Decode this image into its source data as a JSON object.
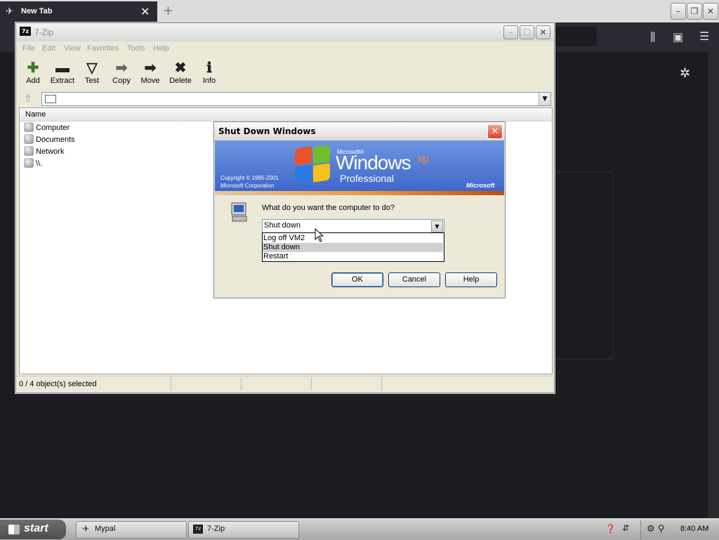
{
  "browser": {
    "tab_title": "New Tab",
    "tab_close": "✕",
    "new_tab": "+",
    "toolbar_icons": [
      "library-icon",
      "sidebar-icon",
      "menu-icon"
    ]
  },
  "zip": {
    "title": "7-Zip",
    "logo": "7z",
    "menu": [
      "File",
      "Edit",
      "View",
      "Favorites",
      "Tools",
      "Help"
    ],
    "tools": [
      {
        "label": "Add",
        "glyph": "✚"
      },
      {
        "label": "Extract",
        "glyph": "▬"
      },
      {
        "label": "Test",
        "glyph": "▽"
      },
      {
        "label": "Copy",
        "glyph": "➡"
      },
      {
        "label": "Move",
        "glyph": "➡"
      },
      {
        "label": "Delete",
        "glyph": "✖"
      },
      {
        "label": "Info",
        "glyph": "ℹ"
      }
    ],
    "column_name": "Name",
    "items": [
      "Computer",
      "Documents",
      "Network",
      "\\\\."
    ],
    "status": "0 / 4 object(s) selected"
  },
  "dialog": {
    "title": "Shut Down Windows",
    "banner": {
      "microsoft_small": "Microsoft®",
      "windows": "Windows",
      "xp": "xp",
      "professional": "Professional",
      "copyright_line1": "Copyright © 1985-2001",
      "copyright_line2": "Microsoft Corporation",
      "ms_logo": "Microsoft"
    },
    "question": "What do you want the computer to do?",
    "selected": "Shut down",
    "options": [
      "Log off VM2",
      "Shut down",
      "Restart"
    ],
    "selected_index": 1,
    "buttons": {
      "ok": "OK",
      "cancel": "Cancel",
      "help": "Help"
    }
  },
  "taskbar": {
    "start": "start",
    "tasks": [
      "Mypal",
      "7-Zip"
    ],
    "clock": "8:40 AM"
  }
}
